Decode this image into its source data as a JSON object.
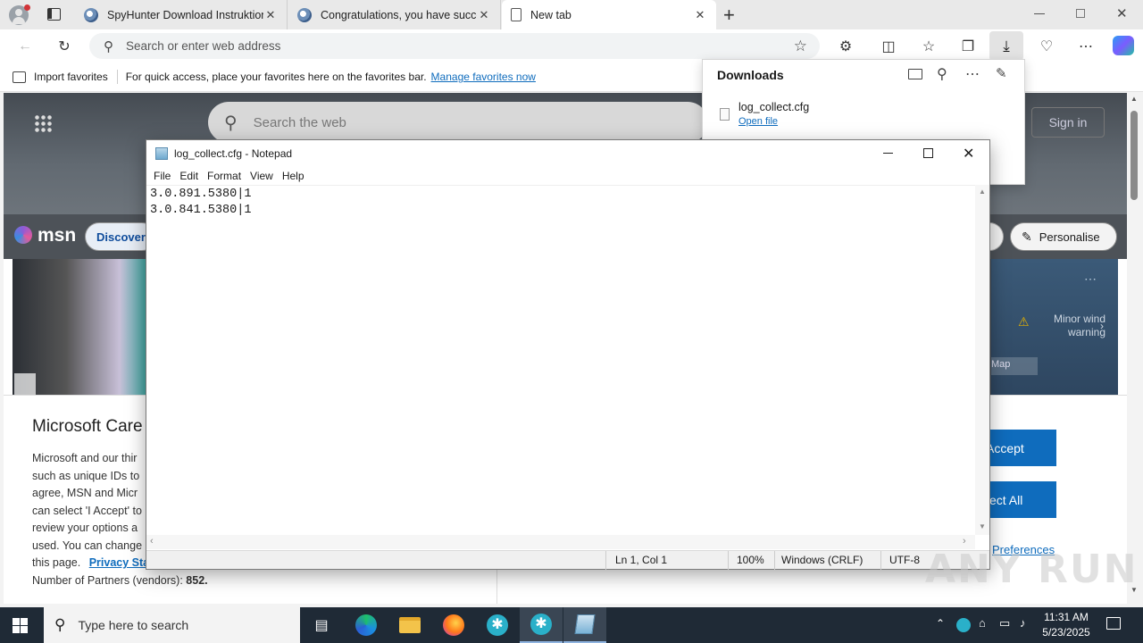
{
  "browser": {
    "tabs": [
      {
        "title": "SpyHunter Download Instruktion",
        "active": false
      },
      {
        "title": "Congratulations, you have succe",
        "active": false
      },
      {
        "title": "New tab",
        "active": true
      }
    ],
    "address_placeholder": "Search or enter web address"
  },
  "favorites_bar": {
    "import_label": "Import favorites",
    "hint": "For quick access, place your favorites here on the favorites bar.",
    "manage_link": "Manage favorites now"
  },
  "downloads": {
    "title": "Downloads",
    "items": [
      {
        "filename": "log_collect.cfg",
        "action": "Open file"
      }
    ]
  },
  "ntp": {
    "search_placeholder": "Search the web",
    "sign_in": "Sign in",
    "msn_logo": "msn",
    "discover": "Discover",
    "personalise": "Personalise",
    "weather_warning": "Minor wind warning",
    "map_label": "Map",
    "consent": {
      "title": "Microsoft Care",
      "lines": [
        "Microsoft and our thir",
        "such as unique IDs to",
        "agree, MSN and Micr",
        "can select 'I Accept' to",
        "review your options a",
        "used.  You can change",
        "this page."
      ],
      "privacy_link": "Privacy Sta",
      "partners_label": "Number of Partners (vendors):",
      "partners_count": "852.",
      "accept": "Accept",
      "reject_all": "ect All",
      "preferences": "Preferences"
    }
  },
  "notepad": {
    "title": "log_collect.cfg - Notepad",
    "menu": [
      "File",
      "Edit",
      "Format",
      "View",
      "Help"
    ],
    "content": "3.0.891.5380|1\n3.0.841.5380|1",
    "status": {
      "position": "Ln 1, Col 1",
      "zoom": "100%",
      "line_ending": "Windows (CRLF)",
      "encoding": "UTF-8"
    }
  },
  "taskbar": {
    "search_placeholder": "Type here to search",
    "time": "11:31 AM",
    "date": "5/23/2025"
  },
  "watermark": "ANY RUN",
  "colors": {
    "accent_blue": "#0f6cbd",
    "link_blue": "#0063b1",
    "taskbar": "#1f2a36"
  }
}
